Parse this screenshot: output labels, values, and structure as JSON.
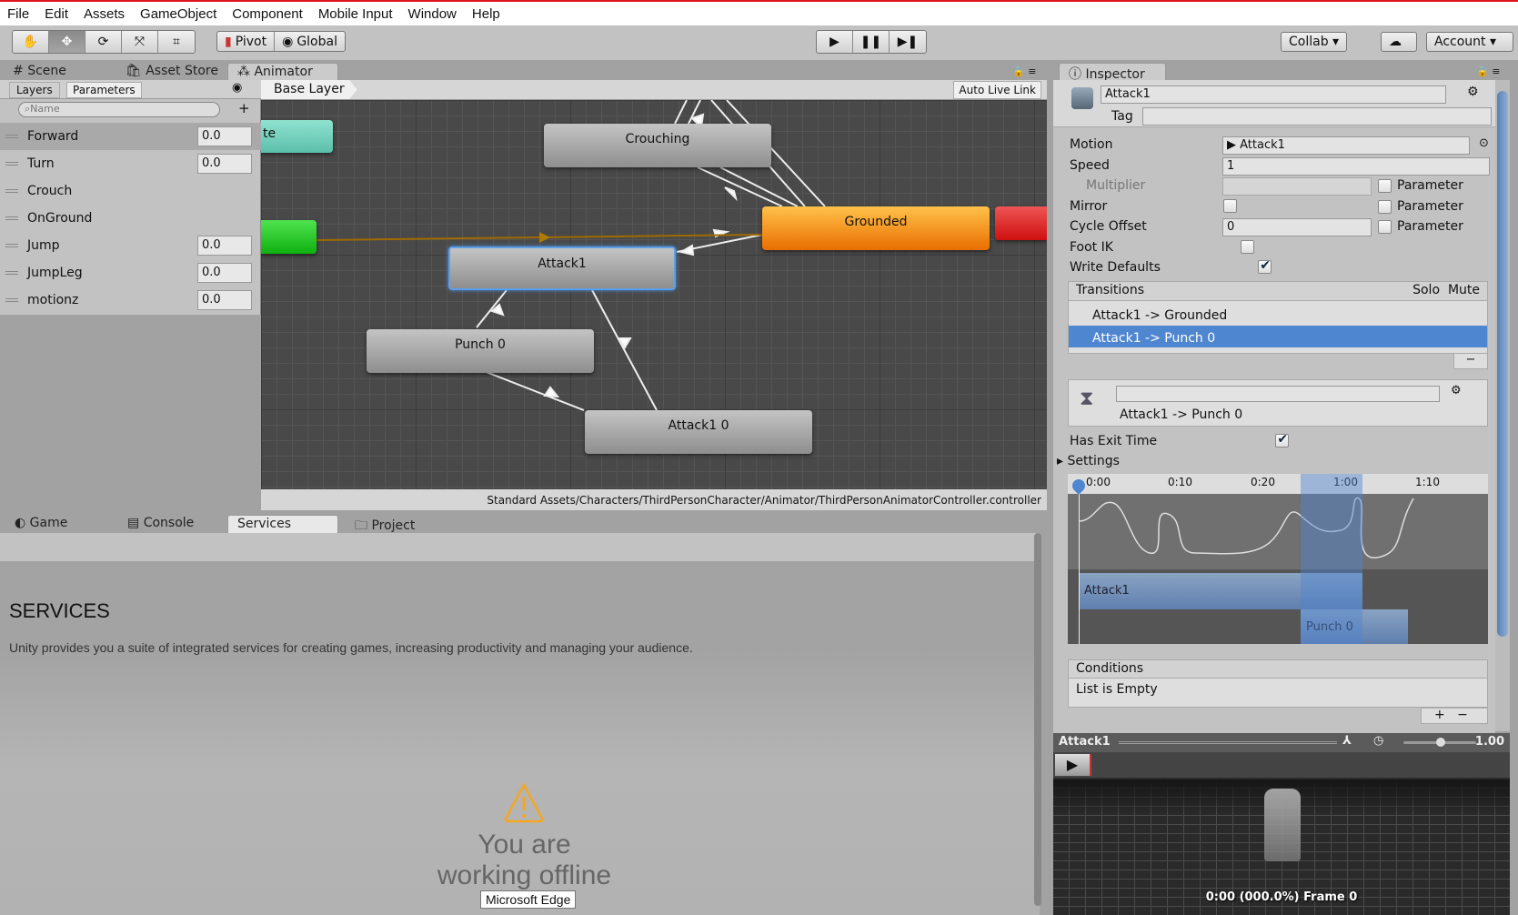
{
  "menu": [
    "File",
    "Edit",
    "Assets",
    "GameObject",
    "Component",
    "Mobile Input",
    "Window",
    "Help"
  ],
  "toolbar": {
    "tools": [
      "hand-icon",
      "move-icon",
      "rotate-icon",
      "scale-icon",
      "rect-icon"
    ],
    "pivot": "Pivot",
    "global": "Global",
    "collab": "Collab ▾",
    "account": "Account"
  },
  "top_tabs": [
    "Scene",
    "Asset Store",
    "Animator"
  ],
  "animator": {
    "layers_tab": "Layers",
    "params_tab": "Parameters",
    "search_placeholder": "Name",
    "breadcrumb": "Base Layer",
    "auto_live_link": "Auto Live Link",
    "parameters": [
      {
        "name": "Forward",
        "type": "float",
        "value": "0.0"
      },
      {
        "name": "Turn",
        "type": "float",
        "value": "0.0"
      },
      {
        "name": "Crouch",
        "type": "bool",
        "value": false
      },
      {
        "name": "OnGround",
        "type": "bool",
        "value": true
      },
      {
        "name": "Jump",
        "type": "float",
        "value": "0.0"
      },
      {
        "name": "JumpLeg",
        "type": "float",
        "value": "0.0"
      },
      {
        "name": "motionz",
        "type": "float",
        "value": "0.0"
      }
    ],
    "nodes": {
      "any": "te",
      "crouching": "Crouching",
      "grounded": "Grounded",
      "attack1": "Attack1",
      "punch0": "Punch 0",
      "attack1_0": "Attack1 0"
    },
    "path": "Standard Assets/Characters/ThirdPersonCharacter/Animator/ThirdPersonAnimatorController.controller"
  },
  "bottom_tabs": [
    "Game",
    "Console",
    "Services",
    "Project"
  ],
  "services": {
    "title": "SERVICES",
    "desc": "Unity provides you a suite of integrated services for creating games, increasing productivity and managing your audience.",
    "offline1": "You are",
    "offline2": "working offline",
    "tooltip": "Microsoft Edge"
  },
  "inspector": {
    "tab": "Inspector",
    "name": "Attack1",
    "tag_label": "Tag",
    "tag": "",
    "motion_label": "Motion",
    "motion": "Attack1",
    "speed_label": "Speed",
    "speed": "1",
    "multiplier_label": "Multiplier",
    "mirror_label": "Mirror",
    "cycle_label": "Cycle Offset",
    "cycle": "0",
    "footik_label": "Foot IK",
    "write_label": "Write Defaults",
    "parameter": "Parameter",
    "mirror": false,
    "foot_ik": false,
    "write_defaults": true,
    "transitions_label": "Transitions",
    "solo": "Solo",
    "mute": "Mute",
    "transitions": [
      "Attack1 -> Grounded",
      "Attack1 -> Punch 0"
    ],
    "selected_transition": "Attack1 -> Punch 0",
    "has_exit_label": "Has Exit Time",
    "has_exit": true,
    "settings": "Settings",
    "timeline_ticks": [
      "0:00",
      "0:10",
      "0:20",
      "1:00",
      "1:10"
    ],
    "clip_a": "Attack1",
    "clip_b": "Punch 0",
    "conditions": "Conditions",
    "conditions_empty": "List is Empty",
    "preview_title": "Attack1",
    "preview_speed": "1.00",
    "preview_time": "0:00 (000.0%) Frame 0"
  },
  "colors": {
    "grounded": "#f39a1a",
    "selected": "#4f86d0",
    "entry": "#12c412",
    "exit": "#dd1b1b",
    "any": "#6ecfbd",
    "warning": "#f5a623"
  }
}
